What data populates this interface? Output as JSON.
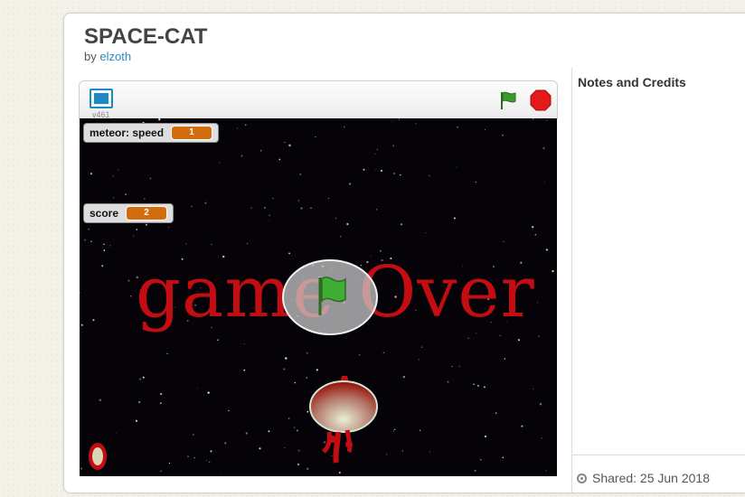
{
  "project": {
    "title": "SPACE-CAT",
    "by_prefix": "by",
    "author": "elzoth"
  },
  "sidebar": {
    "notes_title": "Notes and Credits",
    "shared": "Shared: 25 Jun 2018"
  },
  "player": {
    "version": "v461",
    "fullscreen_icon": "fullscreen-icon",
    "flag_icon": "green-flag-icon",
    "stop_icon": "stop-icon"
  },
  "stage": {
    "monitors": [
      {
        "label": "meteor: speed",
        "value": "1"
      },
      {
        "label": "score",
        "value": "2"
      }
    ],
    "game_over_text": "game Over",
    "colors": {
      "monitor_value": "#d36b0f",
      "game_over": "#c40d12",
      "flag": "#3a9b2b",
      "stop": "#e21a1a",
      "accent": "#1e88c7"
    }
  }
}
